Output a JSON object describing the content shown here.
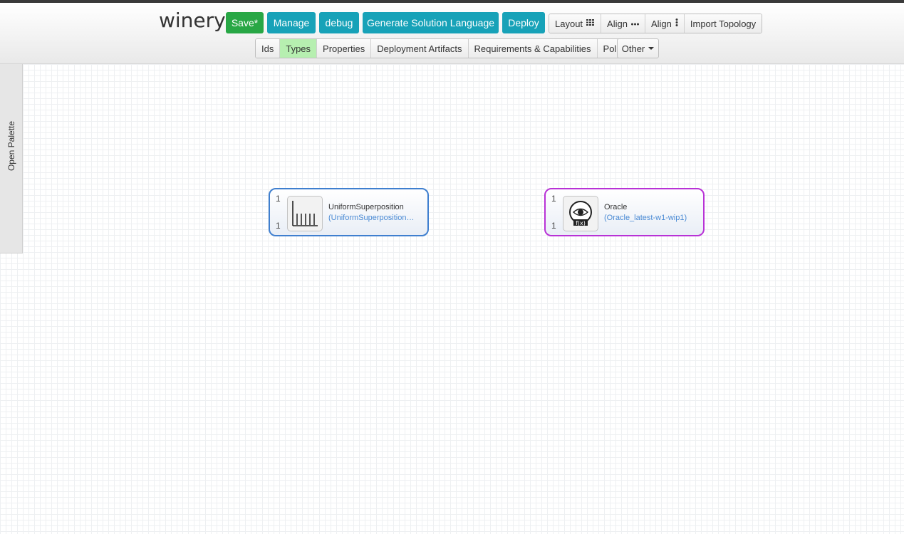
{
  "header": {
    "app_title": "winery",
    "buttons": {
      "save": "Save*",
      "manage": "Manage",
      "debug": "debug",
      "generate": "Generate Solution Language",
      "deploy": "Deploy"
    },
    "tools": {
      "layout": "Layout",
      "align_horizontal": "Align",
      "align_vertical": "Align",
      "import_topology": "Import Topology"
    },
    "view_tabs": [
      {
        "label": "Ids",
        "active": false
      },
      {
        "label": "Types",
        "active": true
      },
      {
        "label": "Properties",
        "active": false
      },
      {
        "label": "Deployment Artifacts",
        "active": false
      },
      {
        "label": "Requirements & Capabilities",
        "active": false
      },
      {
        "label": "Policies",
        "active": false
      }
    ],
    "other": "Other"
  },
  "palette": {
    "label": "Open Palette"
  },
  "nodes": [
    {
      "name": "UniformSuperposition",
      "type": "(UniformSuperposition_lat…",
      "min": "1",
      "max": "1",
      "border_color": "#3f7fcf",
      "icon": "histogram-icon"
    },
    {
      "name": "Oracle",
      "type": "(Oracle_latest-w1-wip1)",
      "min": "1",
      "max": "1",
      "border_color": "#b832d6",
      "icon": "eye-function-icon"
    }
  ],
  "colors": {
    "save": "#28a745",
    "primary": "#17a2b8",
    "active_tab": "#b6efb0"
  }
}
